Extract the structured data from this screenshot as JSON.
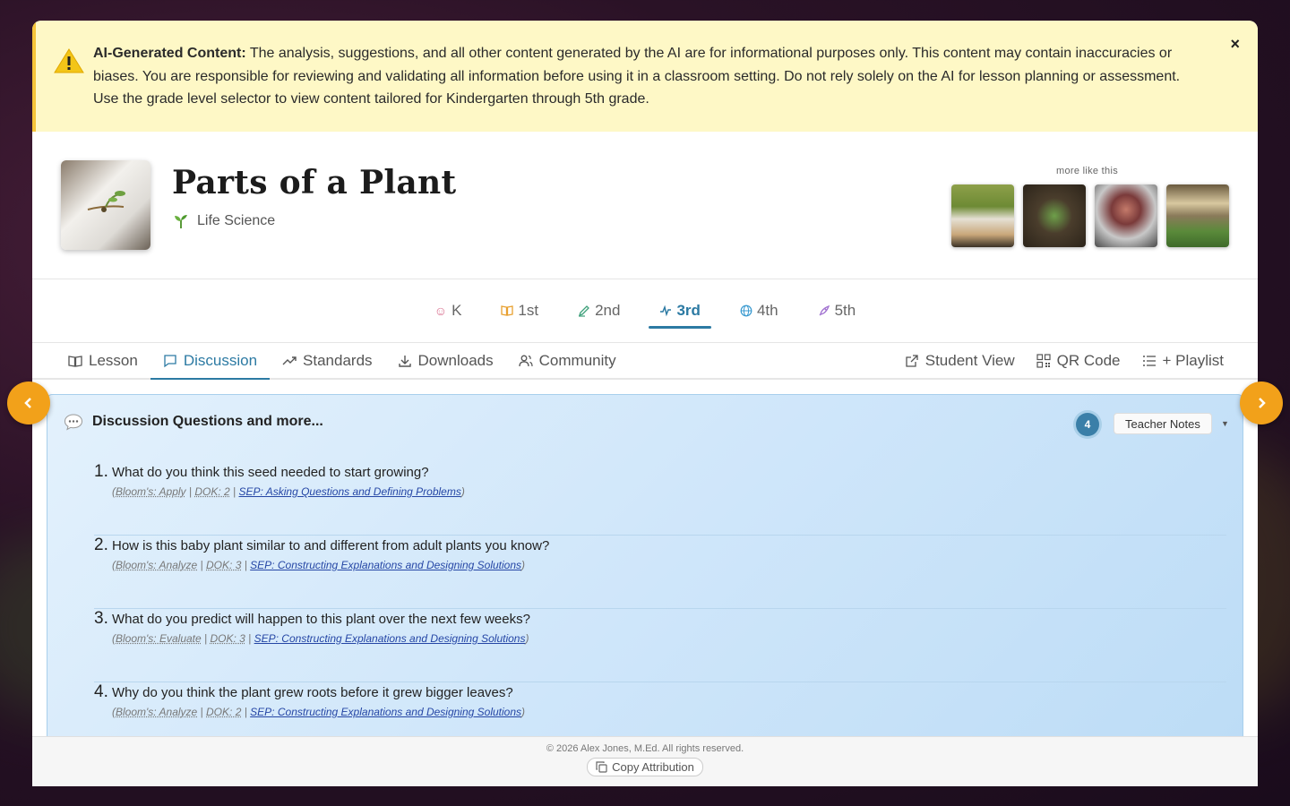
{
  "banner": {
    "label": "AI-Generated Content:",
    "text": " The analysis, suggestions, and all other content generated by the AI are for informational purposes only. This content may contain inaccuracies or biases. You are responsible for reviewing and validating all information before using it in a classroom setting. Do not rely solely on the AI for lesson planning or assessment. Use the grade level selector to view content tailored for Kindergarten through 5th grade.",
    "close": "×",
    "icon": "warning-triangle-icon"
  },
  "lesson": {
    "title": "Parts of a Plant",
    "subject": "Life Science",
    "subject_icon": "seedling-icon",
    "more_label": "more like this"
  },
  "grades": [
    {
      "label": "K",
      "icon": "☺",
      "color": "#d86a8a"
    },
    {
      "label": "1st",
      "icon": "📖",
      "color": "#e8a030"
    },
    {
      "label": "2nd",
      "icon": "✎",
      "color": "#3ea07a"
    },
    {
      "label": "3rd",
      "icon": "〜",
      "color": "#2c7aa3",
      "active": true
    },
    {
      "label": "4th",
      "icon": "◍",
      "color": "#3a9ad0"
    },
    {
      "label": "5th",
      "icon": "🚀",
      "color": "#a070d0"
    }
  ],
  "tabs": {
    "lesson": "Lesson",
    "discussion": "Discussion",
    "standards": "Standards",
    "downloads": "Downloads",
    "community": "Community",
    "student_view": "Student View",
    "qr_code": "QR Code",
    "playlist": "+ Playlist"
  },
  "discussion": {
    "heading": "Discussion Questions and more...",
    "count": "4",
    "teacher_notes": "Teacher Notes",
    "arrow": "▼",
    "questions": [
      {
        "num": "1.",
        "text": "What do you think this seed needed to start growing?",
        "bloom": "Bloom's: Apply",
        "dok": "DOK: 2",
        "sep": "SEP: Asking Questions and Defining Problems"
      },
      {
        "num": "2.",
        "text": "How is this baby plant similar to and different from adult plants you know?",
        "bloom": "Bloom's: Analyze",
        "dok": "DOK: 3",
        "sep": "SEP: Constructing Explanations and Designing Solutions"
      },
      {
        "num": "3.",
        "text": "What do you predict will happen to this plant over the next few weeks?",
        "bloom": "Bloom's: Evaluate",
        "dok": "DOK: 3",
        "sep": "SEP: Constructing Explanations and Designing Solutions"
      },
      {
        "num": "4.",
        "text": "Why do you think the plant grew roots before it grew bigger leaves?",
        "bloom": "Bloom's: Analyze",
        "dok": "DOK: 2",
        "sep": "SEP: Constructing Explanations and Designing Solutions"
      }
    ]
  },
  "footer": {
    "copyright": "© 2026 Alex Jones, M.Ed. All rights reserved.",
    "copy_attribution": "Copy Attribution"
  },
  "nav": {
    "prev": "‹",
    "next": "›"
  }
}
